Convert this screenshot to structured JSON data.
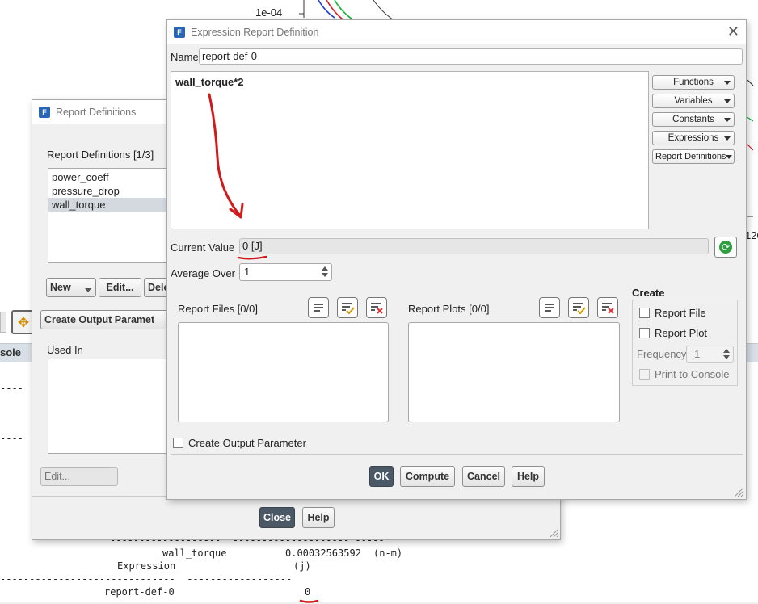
{
  "background": {
    "plot_tick_label": "1e-04",
    "plot_axis_fragment": "120",
    "console_tab": "sole",
    "console": {
      "row1_name": "wall_torque",
      "row1_value": "0.00032563592",
      "row1_unit": "(n-m)",
      "row2_name": "Expression",
      "row2_unit": "(j)",
      "row3_name": "report-def-0",
      "row3_value": "0"
    }
  },
  "report_definitions_dialog": {
    "title": "Report Definitions",
    "list_label": "Report Definitions [1/3]",
    "items": [
      "power_coeff",
      "pressure_drop",
      "wall_torque"
    ],
    "selected": "wall_torque",
    "new_label": "New",
    "edit_label": "Edit...",
    "delete_label": "Dele",
    "create_output_label": "Create Output Paramet",
    "used_in_label": "Used In",
    "used_in_edit_label": "Edit...",
    "close_label": "Close",
    "help_label": "Help"
  },
  "expression_dialog": {
    "title": "Expression Report Definition",
    "name_label": "Name",
    "name_value": "report-def-0",
    "expression": "wall_torque*2",
    "menus": [
      "Functions",
      "Variables",
      "Constants",
      "Expressions",
      "Report Definitions"
    ],
    "current_value_label": "Current Value",
    "current_value": "0 [J]",
    "average_over_label": "Average Over",
    "average_over_value": "1",
    "report_files_label": "Report Files [0/0]",
    "report_plots_label": "Report Plots [0/0]",
    "create_label": "Create",
    "report_file_label": "Report File",
    "report_plot_label": "Report Plot",
    "frequency_label": "Frequency",
    "frequency_value": "1",
    "print_console_label": "Print to Console",
    "create_output_param_label": "Create Output Parameter",
    "ok_label": "OK",
    "compute_label": "Compute",
    "cancel_label": "Cancel",
    "help_label": "Help"
  },
  "colors": {
    "annotation_red": "#d11a1a",
    "primary_button": "#4b5866",
    "plot_blue": "#1f3fd8",
    "plot_red": "#d62020",
    "plot_green": "#19b33a"
  }
}
